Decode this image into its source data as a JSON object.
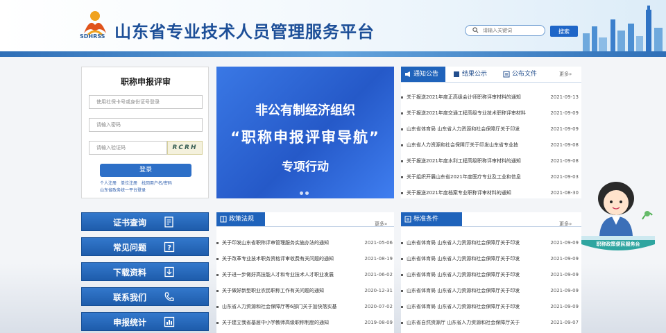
{
  "header": {
    "logo_text": "SDHRSS",
    "title": "山东省专业技术人员管理服务平台",
    "search_placeholder": "请输入关键词",
    "search_button": "搜索"
  },
  "login": {
    "title": "职称申报评审",
    "username_placeholder": "使用社保卡号或身份证号登录",
    "password_placeholder": "请输入密码",
    "captcha_placeholder": "请输入验证码",
    "captcha_text": "RCRH",
    "login_button": "登录",
    "links": [
      "个人注册",
      "单位注册",
      "找回用户名/密码",
      "山东省政务统一平台登录"
    ]
  },
  "sidebar": {
    "buttons": [
      {
        "label": "证书查询",
        "icon": "certificate-icon"
      },
      {
        "label": "常见问题",
        "icon": "question-icon"
      },
      {
        "label": "下载资料",
        "icon": "download-icon"
      },
      {
        "label": "联系我们",
        "icon": "phone-icon"
      },
      {
        "label": "申报统计",
        "icon": "chart-icon"
      }
    ]
  },
  "banner": {
    "line1": "非公有制经济组织",
    "line2": "“职称申报评审导航”",
    "line3": "专项行动"
  },
  "notice_panel": {
    "tabs": [
      "通知公告",
      "结果公示",
      "公布文件"
    ],
    "more": "更多»",
    "items": [
      {
        "text": "关于报送2021年度正高级会计师职称评审材料的通知",
        "date": "2021-09-13"
      },
      {
        "text": "关于报送2021年度交通工程高级专业技术职称评审材料",
        "date": "2021-09-09"
      },
      {
        "text": "山东省体育局 山东省人力资源和社会保障厅关于印发",
        "date": "2021-09-09"
      },
      {
        "text": "山东省人力资源和社会保障厅关于印发山东省专业技",
        "date": "2021-09-08"
      },
      {
        "text": "关于报送2021年度水利工程高级职称评审材料的通知",
        "date": "2021-09-08"
      },
      {
        "text": "关于组织开展山东省2021年度医疗专业及工业和信息",
        "date": "2021-09-03"
      },
      {
        "text": "关于报送2021年度档案专业职称评审材料的通知",
        "date": "2021-08-30"
      }
    ]
  },
  "policy_panel": {
    "title": "政策法规",
    "more": "更多»",
    "items": [
      {
        "text": "关于印发山东省职称评审管理服务实施办法的通知",
        "date": "2021-05-06"
      },
      {
        "text": "关于改革专业技术职务资格评审收费有关问题的通知",
        "date": "2021-08-19"
      },
      {
        "text": "关于进一步做好高技能人才和专业技术人才职业发展",
        "date": "2021-06-02"
      },
      {
        "text": "关于做好新型职业农民职称工作有关问题的通知",
        "date": "2020-12-31"
      },
      {
        "text": "山东省人力资源和社会保障厅等6部门关于加快落实基",
        "date": "2020-07-02"
      },
      {
        "text": "关于建立我省基层中小学教师高级职称制度的通知",
        "date": "2019-08-09"
      }
    ]
  },
  "standard_panel": {
    "title": "标准条件",
    "more": "更多»",
    "items": [
      {
        "text": "山东省体育局 山东省人力资源和社会保障厅关于印发",
        "date": "2021-09-09"
      },
      {
        "text": "山东省体育局 山东省人力资源和社会保障厅关于印发",
        "date": "2021-09-09"
      },
      {
        "text": "山东省体育局 山东省人力资源和社会保障厅关于印发",
        "date": "2021-09-09"
      },
      {
        "text": "山东省体育局 山东省人力资源和社会保障厅关于印发",
        "date": "2021-09-09"
      },
      {
        "text": "山东省体育局 山东省人力资源和社会保障厅关于印发",
        "date": "2021-09-09"
      },
      {
        "text": "山东省自然资源厅 山东省人力资源和社会保障厅关于",
        "date": "2021-09-07"
      }
    ]
  },
  "mascot": {
    "label": "职称政策便民服务台"
  },
  "colors": {
    "primary": "#1f63bb",
    "title": "#1d4f98",
    "banner": "#2559c8"
  }
}
